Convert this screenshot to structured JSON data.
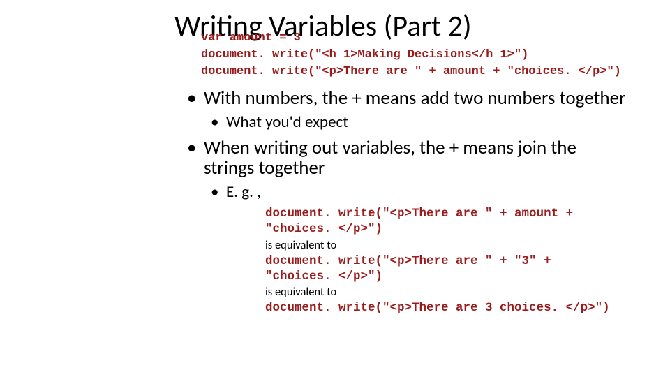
{
  "title": "Writing Variables (Part 2)",
  "top_code": {
    "line1": "var amount = 3",
    "line2": "document. write(\"<h 1>Making Decisions</h 1>\")",
    "line3": "document. write(\"<p>There are \" + amount + \"choices. </p>\")"
  },
  "bullets": {
    "b1": "With numbers, the + means add two numbers together",
    "b1_sub1": "What you'd expect",
    "b2": "When writing out variables, the + means join the strings together",
    "b2_sub1": "E. g. ,"
  },
  "example": {
    "code1a": "document. write(\"<p>There are \" + amount +",
    "code1b": "\"choices. </p>\")",
    "note1": "is equivalent to",
    "code2a": "document. write(\"<p>There are \" + \"3\" +",
    "code2b": "\"choices. </p>\")",
    "note2": "is equivalent to",
    "code3": "document. write(\"<p>There are 3 choices. </p>\")"
  }
}
